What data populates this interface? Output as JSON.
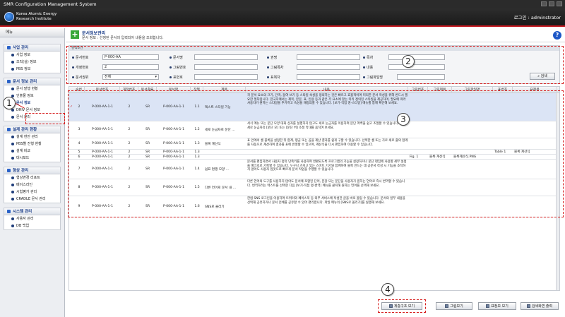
{
  "window": {
    "title": "SMR Configuration Management System"
  },
  "header": {
    "org_line1": "Korea Atomic Energy",
    "org_line2": "Research Institute",
    "login_label": "로그인 : adminstrator"
  },
  "sidebar": {
    "head": "메뉴",
    "groups": [
      {
        "title": "사업 관리",
        "items": [
          "사업 정보",
          "조직(실) 정보",
          "PBS 정보"
        ]
      },
      {
        "title": "문서 정보 관리",
        "items": [
          "문서 발행 현황",
          "인출물 정보",
          "문서 정보",
          "DRIV 문서 정보",
          "문서 관리"
        ]
      },
      {
        "title": "설계 관리 현황",
        "items": [
          "설계 현안 관리",
          "PBS별 진행 현황",
          "설계 비교",
          "대시보드"
        ]
      },
      {
        "title": "형상 관리",
        "items": [
          "형상변경 리포트",
          "베이스라인",
          "시험평가 관리",
          "CRADLE 문서 관리"
        ]
      },
      {
        "title": "시스템 관리",
        "items": [
          "사용자 관리",
          "DB 백업"
        ]
      }
    ]
  },
  "page": {
    "title": "문서정보관리",
    "desc": "문서 정보 : 선정된 문서의 입력되어 내용을 조회합니다."
  },
  "search": {
    "panel_title": "검색조건",
    "labels": [
      "문서번호",
      "문서명",
      "권명",
      "목차",
      "개정번호",
      "그림번호",
      "그림목차",
      "내용",
      "문서권위",
      "표번호",
      "표목차",
      "그림파일명"
    ],
    "doc_no_value": "P-000-AA",
    "rev_value": "2",
    "auth_value": "전체",
    "search_button": "검색"
  },
  "table": {
    "headers": [
      "순번",
      "문서번호",
      "개정번호",
      "문서종류",
      "문서명",
      "장절",
      "제목",
      "내용",
      "그림번호",
      "그림제목",
      "그림파일명",
      "표번호",
      "표제목"
    ],
    "rows": [
      {
        "no": "2",
        "doc": "P-000-AA-1-1",
        "rev": "2",
        "kind": "SR",
        "name": "P-000-AA-1-1",
        "sec": "1.1",
        "title": "텍스트 스타일 기능",
        "content": "각 문서 요소의 크기, 간격, 들여 쓰기 등 스타일 속성을 정의하는 것은 빠르고 효율적이며 미리한 문서 작성을 위해 반드시 필요한 절차입니다. 한국지에서는 제목, 본문, 표, 인용 등과 같은 각 요소에 맞는 미리 정의된 스타일을 제공하며, 필요에 따라 사용자가 원하는 스타일을 추가하고 속성을 재정의할 수 있습니다. [보기-직접 명-스타일] 메뉴를 통해 확인해 보세요.",
        "fig": "",
        "figt": "",
        "figf": "",
        "tab": "",
        "tabt": "",
        "selected": true
      },
      {
        "no": "3",
        "doc": "P-000-AA-1-1",
        "rev": "2",
        "kind": "SR",
        "name": "P-000-AA-1-1",
        "sec": "1.2",
        "title": "세로 눈금자로 문단 ...",
        "content": "서식 메뉴 또는 문단 모양 대화 상자를 실행하지 않고도 세로 눈금자를 이용하여 문단 여백을 쉽고 조절할 수 있습니다. 화면 세로 눈금자의 [문단 모] 또는 [문단 버] 조절 막대를 움직여 보세요.",
        "fig": "",
        "figt": "",
        "figf": "",
        "tab": "",
        "tabt": "",
        "selected": false
      },
      {
        "no": "4",
        "doc": "P-000-AA-1-1",
        "rev": "2",
        "kind": "SR",
        "name": "P-000-AA-1-1",
        "sec": "1.3",
        "title": "블록 계산식",
        "content": "표 안에서 셀 블록을 설정한 뒤 합계, 평균 또는 곱을 계산 결과를 쉽게 구할 수 있습니다. 선택한 셀 또는 가로 세로 줄의 합계를 자동으로 계산하여 결과를 표에 반영할 수 있으며, 계산식을 다시 편집하여 이용할 수 있습니다.",
        "fig": "",
        "figt": "",
        "figf": "",
        "tab": "",
        "tabt": "",
        "selected": false
      },
      {
        "no": "5",
        "doc": "P-000-AA-1-1",
        "rev": "2",
        "kind": "SR",
        "name": "P-000-AA-1-1",
        "sec": "1.3",
        "title": "",
        "content": "",
        "fig": "",
        "figt": "",
        "figf": "",
        "tab": "Table 1",
        "tabt": "블록 계산식",
        "selected": false
      },
      {
        "no": "6",
        "doc": "P-000-AA-1-1",
        "rev": "2",
        "kind": "SR",
        "name": "P-000-AA-1-1",
        "sec": "1.3",
        "title": "",
        "content": "",
        "fig": "Fig. 1",
        "figt": "블록 계산식",
        "figf": "블록계산식.PNG",
        "tab": "",
        "tabt": "",
        "selected": false
      },
      {
        "no": "7",
        "doc": "P-000-AA-1-1",
        "rev": "2",
        "kind": "SR",
        "name": "P-000-AA-1-1",
        "sec": "1.4",
        "title": "쉽표 편행 모양 ...",
        "content": "문서를 편집하면서 사용자 정의 단축키를 사용하여 반환되도록 프로그램의 기능을 설정하거나 문단 편집에 사용할 세부 설정을 매크로로 기록할 수 있습니다. 누구나 가지고 있는 스마트 기기와 함께하여 블록 만드는 데 공문서 작성 시 기능을 조작하지 않아도 사용자 입맛으로 빠르게 문서 작업을 수행할 수 있습니다.",
        "fig": "",
        "figt": "",
        "figf": "",
        "tab": "",
        "tabt": "",
        "selected": false
      },
      {
        "no": "8",
        "doc": "P-000-AA-1-1",
        "rev": "2",
        "kind": "SR",
        "name": "P-000-AA-1-1",
        "sec": "1.5",
        "title": "다른 언어로 문서 내 ...",
        "content": "다른 언어의 도구를 사용하지 않아도 문서에 포함된 단어, 문장 또는 문단을 사용자가 원하는 언어로 즉시 번역할 수 있습니다. 번역하려는 텍스트를 선택한 다음 [보기-직접 명-번역] 메뉴를 클릭해 원하는 언어를 선택해 보세요.",
        "fig": "",
        "figt": "",
        "figf": "",
        "tab": "",
        "tabt": "",
        "selected": false
      },
      {
        "no": "9",
        "doc": "P-000-AA-1-1",
        "rev": "2",
        "kind": "SR",
        "name": "P-000-AA-1-1",
        "sec": "1.6",
        "title": "SNS로 올리기",
        "content": "한컴 SNS 로그인을 이용하여 트위터와 페이스북 등 외부 서비스에 작성한 글을 바로 올릴 수 있습니다. 문서의 일부 내용을 선택해 공유하거나 문서 전체를 공유할 수 있어 편리합니다. 파일 메뉴의 [SNS로 올리기]를 실행해 보세요.",
        "fig": "",
        "figt": "",
        "figf": "",
        "tab": "",
        "tabt": "",
        "selected": false
      }
    ]
  },
  "bottom": {
    "buttons": [
      "계층구조 보기",
      "그림보기",
      "표정보 보기",
      "검색화면 출력"
    ]
  },
  "annotations": [
    "1",
    "2",
    "3",
    "4"
  ],
  "colors": {
    "accent": "#c4171e",
    "annotation": "#d61c1c",
    "selection": "#dbe4f5",
    "brand_blue": "#1d3f8a"
  }
}
